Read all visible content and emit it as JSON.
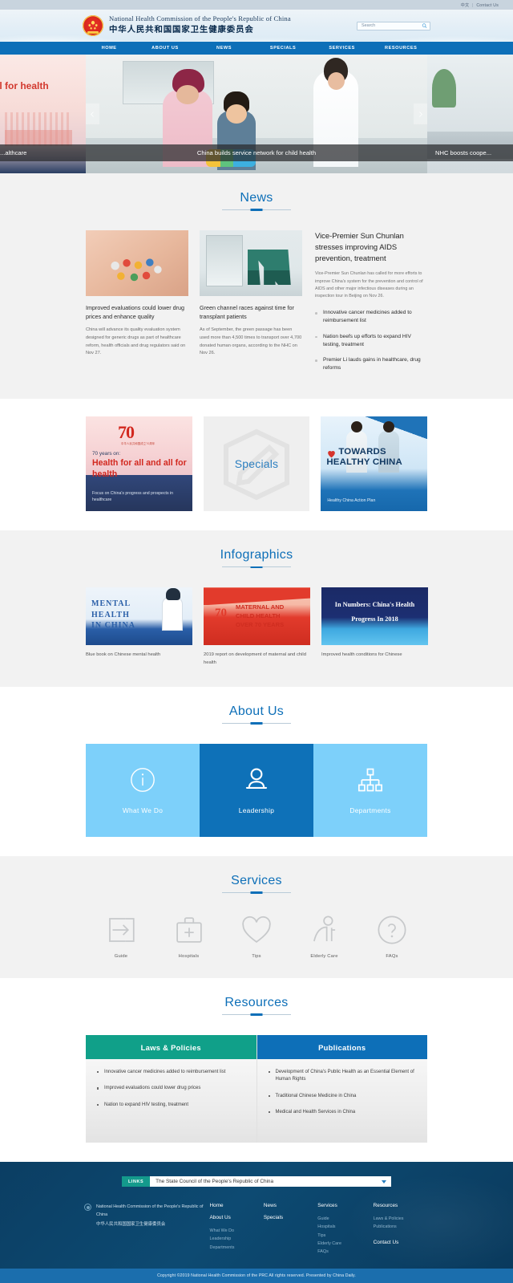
{
  "topbar": {
    "lang": "中文",
    "separator": "|",
    "contact": "Contact Us"
  },
  "header": {
    "title_en": "National Health Commission of the People's Republic of China",
    "title_cn": "中华人民共和国国家卫生健康委员会",
    "emblem_icon": "china-national-emblem-icon",
    "search": {
      "placeholder": "Search",
      "value": "",
      "icon": "search-icon"
    }
  },
  "nav": {
    "items": [
      "HOME",
      "ABOUT US",
      "NEWS",
      "SPECIALS",
      "SERVICES",
      "RESOURCES"
    ]
  },
  "carousel": {
    "prev_icon": "chevron-left-icon",
    "next_icon": "chevron-right-icon",
    "slides": [
      {
        "caption": "...althcare"
      },
      {
        "caption": "China builds service network for child health"
      },
      {
        "caption": "NHC boosts coope..."
      }
    ]
  },
  "news": {
    "title": "News",
    "cards": [
      {
        "headline": "Improved evaluations could lower drug prices and enhance quality",
        "body": "China will advance its quality evaluation system designed for generic drugs as part of healthcare reform, health officials and drug regulators said on Nov 27."
      },
      {
        "headline": "Green channel races against time for transplant patients",
        "body": "As of September, the green passage has been used more than 4,500 times to transport over 4,700 donated human organs, according to the NHC on Nov 26."
      }
    ],
    "lead": {
      "title": "Vice-Premier Sun Chunlan stresses improving AIDS prevention, treatment",
      "body": "Vice-Premier Sun Chunlan has called for more efforts to improve China's system for the prevention and control of AIDS and other major infectious diseases during an inspection tour in Beijing on Nov 26.",
      "links": [
        "Innovative cancer medicines added to reimbursement list",
        "Nation beefs up efforts to expand HIV testing, treatment",
        "Premier Li lauds gains in healthcare, drug reforms"
      ]
    }
  },
  "specials": {
    "label": "Specials",
    "icon": "pencil-icon",
    "left": {
      "anniversary": "70",
      "anniversary_sup": "",
      "sub_cn": "中华人民共和国成立70周年",
      "kicker": "70 years on:",
      "headline": "Health for all and all for health",
      "caption": "Focus on China's progress and prospects in healthcare"
    },
    "right": {
      "line1": "TOWARDS",
      "line2": "HEALTHY CHINA",
      "heart_icon": "heart-icon",
      "caption": "Healthy China Action Plan"
    }
  },
  "infographics": {
    "title": "Infographics",
    "cards": [
      {
        "art_line1": "MENTAL",
        "art_line2": "HEALTH",
        "art_line3": "IN CHINA",
        "caption": "Blue book on Chinese mental health"
      },
      {
        "art_line1": "MATERNAL AND",
        "art_line2": "CHILD HEALTH",
        "art_line3": "OVER 70 YEARS",
        "art_badge": "70",
        "caption": "2019 report on development of maternal and child health"
      },
      {
        "art_line1": "In Numbers: China's Health",
        "art_line2": "Progress In 2018",
        "caption": "Improved health conditions for Chinese"
      }
    ]
  },
  "about": {
    "title": "About Us",
    "tiles": [
      {
        "label": "What We Do",
        "icon": "info-circle-icon",
        "active": false
      },
      {
        "label": "Leadership",
        "icon": "person-icon",
        "active": true
      },
      {
        "label": "Departments",
        "icon": "org-chart-icon",
        "active": false
      }
    ]
  },
  "services": {
    "title": "Services",
    "items": [
      {
        "label": "Guide",
        "icon": "arrow-into-box-icon"
      },
      {
        "label": "Hospitals",
        "icon": "medical-kit-icon"
      },
      {
        "label": "Tips",
        "icon": "heart-icon"
      },
      {
        "label": "Elderly Care",
        "icon": "elderly-person-icon"
      },
      {
        "label": "FAQs",
        "icon": "question-circle-icon"
      }
    ]
  },
  "resources": {
    "title": "Resources",
    "columns": [
      {
        "heading": "Laws & Policies",
        "items": [
          "Innovative cancer medicines added to reimbursement list",
          "Improved evaluations could lower drug prices",
          "Nation to expand HIV testing, treatment"
        ]
      },
      {
        "heading": "Publications",
        "items": [
          "Development of China's Public Health as an Essential Element of Human Rights",
          "Traditional Chinese Medicine in China",
          "Medical and Health Services in China"
        ]
      }
    ]
  },
  "footer": {
    "links_tag": "LINKS",
    "links_selected": "The State Council of the People's Republic of China",
    "brand_en": "National Health Commission of the People's Republic of China",
    "brand_cn": "中华人民共和国国家卫生健康委员会",
    "emblem_icon": "china-national-emblem-icon",
    "columns": [
      {
        "main": [
          "Home",
          "About Us"
        ],
        "sub": [
          "What We Do",
          "Leadership",
          "Departments"
        ]
      },
      {
        "main": [
          "News",
          "Specials"
        ],
        "sub": []
      },
      {
        "main": [
          "Services"
        ],
        "sub": [
          "Guide",
          "Hospitals",
          "Tips",
          "Elderly Care",
          "FAQs"
        ]
      },
      {
        "main": [
          "Resources"
        ],
        "sub": [
          "Laws & Policies",
          "Publications"
        ],
        "extra_main": "Contact Us"
      }
    ],
    "copyright": "Copyright ©2019 National Health Commission of the PRC All rights reserved. Presented by China Daily."
  },
  "colors": {
    "nav_blue": "#0d6fb8",
    "tile_light": "#7dd0fa",
    "tile_active": "#0e71b8",
    "teal": "#10a089",
    "footer_dark": "#0b3e63",
    "copyright_bar": "#1b6ead"
  }
}
